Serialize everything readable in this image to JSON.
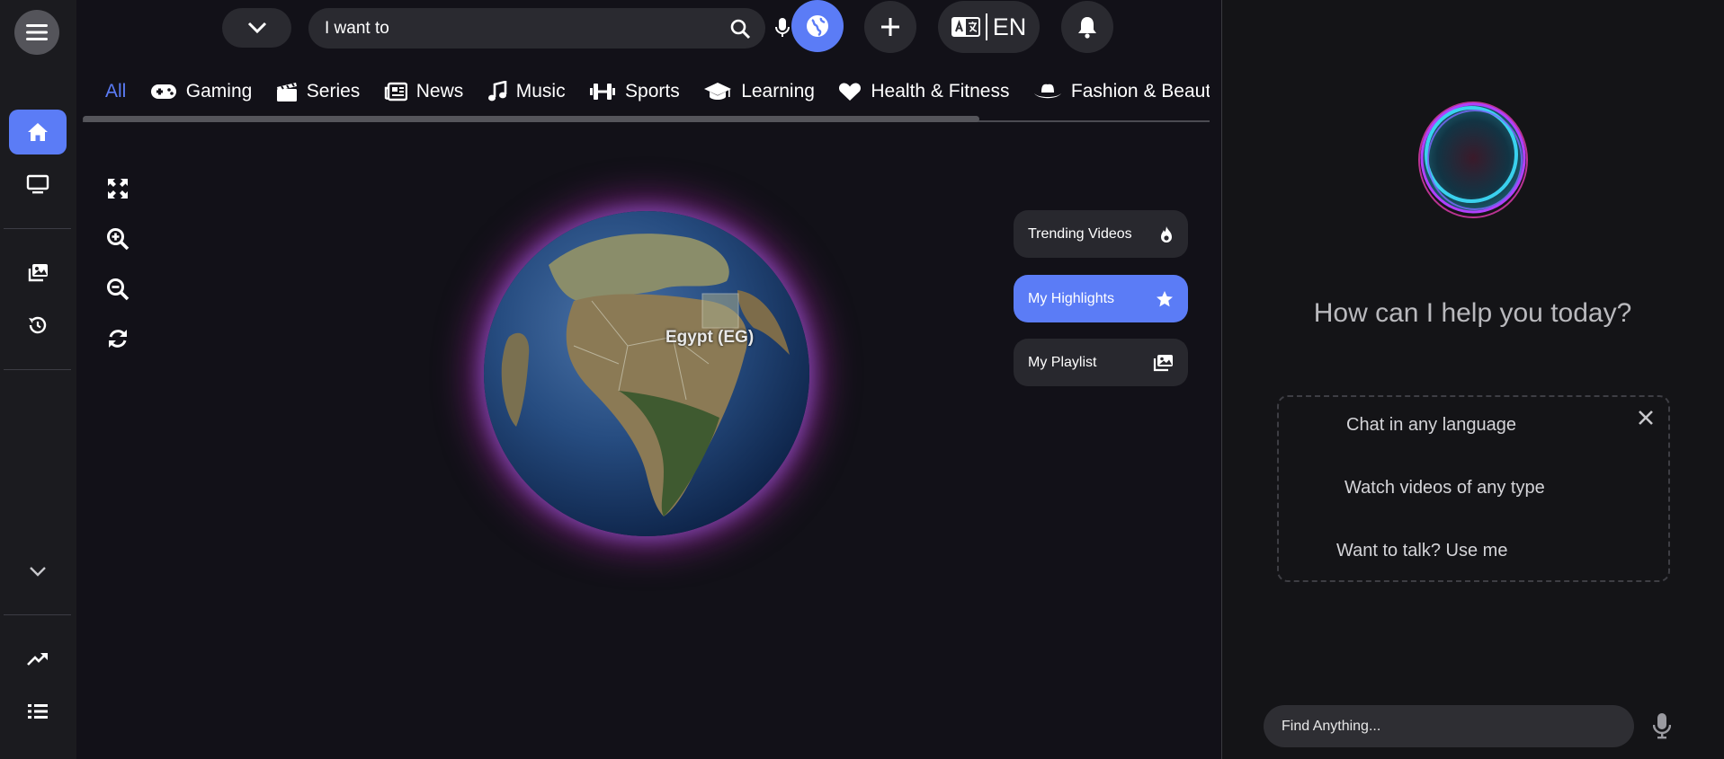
{
  "search": {
    "value": "I want to",
    "placeholder": ""
  },
  "language": {
    "label": "EN"
  },
  "tabs": [
    {
      "label": "All",
      "icon": ""
    },
    {
      "label": "Gaming",
      "icon": "gamepad-icon"
    },
    {
      "label": "Series",
      "icon": "clapperboard-icon"
    },
    {
      "label": "News",
      "icon": "newspaper-icon"
    },
    {
      "label": "Music",
      "icon": "music-note-icon"
    },
    {
      "label": "Sports",
      "icon": "dumbbell-icon"
    },
    {
      "label": "Learning",
      "icon": "graduation-cap-icon"
    },
    {
      "label": "Health & Fitness",
      "icon": "heart-icon"
    },
    {
      "label": "Fashion & Beaut",
      "icon": "hat-icon"
    }
  ],
  "map": {
    "hover_label": "Egypt (EG)"
  },
  "quick_buttons": {
    "trending": "Trending Videos",
    "highlights": "My Highlights",
    "playlist": "My Playlist"
  },
  "assistant": {
    "title": "How can I help you today?",
    "suggestions": [
      "Chat in any language",
      "Watch videos of any type",
      "Want to talk? Use me"
    ],
    "input_placeholder": "Find Anything..."
  },
  "colors": {
    "accent": "#5b7cf6",
    "background": "#121118",
    "panel": "#141417"
  }
}
